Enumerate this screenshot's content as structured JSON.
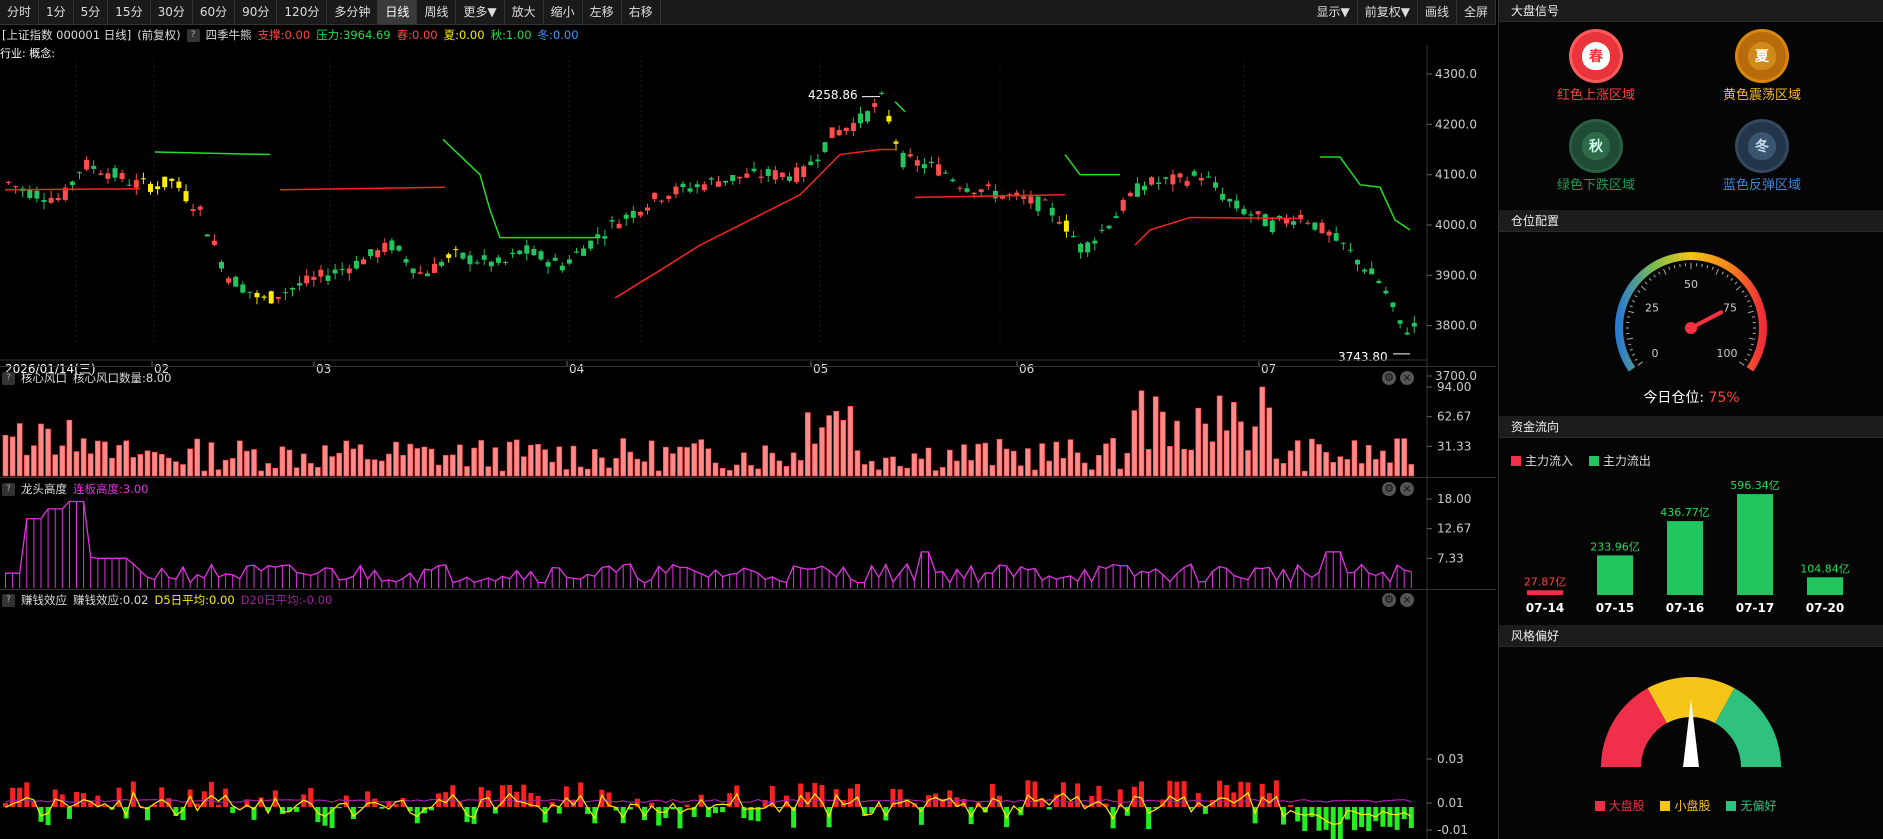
{
  "toolbar": {
    "left": [
      "分时",
      "1分",
      "5分",
      "15分",
      "30分",
      "60分",
      "90分",
      "120分",
      "多分钟",
      "日线",
      "周线",
      "更多▼",
      "放大",
      "缩小",
      "左移",
      "右移"
    ],
    "active": "日线",
    "right": [
      "显示▼",
      "前复权▼",
      "画线",
      "全屏"
    ]
  },
  "info": {
    "title": "[上证指数 000001 日线]",
    "adjust": "(前复权)",
    "indicator": "四季牛熊",
    "support": "支撑:0.00",
    "pressure": "压力:3964.69",
    "spring": "春:0.00",
    "summer": "夏:0.00",
    "autumn": "秋:1.00",
    "winter": "冬:0.00",
    "industry": "行业: 概念:"
  },
  "price_axis": [
    "4300.0",
    "4200.0",
    "4100.0",
    "4000.0",
    "3900.0",
    "3800.0",
    "3700.0"
  ],
  "price_labels": {
    "high": "4258.86",
    "low": "3743.80"
  },
  "date_axis": {
    "cursor": "2026/01/14(三)",
    "months": [
      "02",
      "03",
      "04",
      "05",
      "06",
      "07"
    ]
  },
  "panel1": {
    "name": "核心风口",
    "value": "核心风口数量:8.00",
    "axis": [
      "94.00",
      "62.67",
      "31.33"
    ]
  },
  "panel2": {
    "name": "龙头高度",
    "value": "连板高度:3.00",
    "axis": [
      "18.00",
      "12.67",
      "7.33"
    ]
  },
  "panel3": {
    "name": "赚钱效应",
    "value": "赚钱效应:0.02",
    "d5": "D5日平均:0.00",
    "d20": "D20日平均:-0.00",
    "axis": [
      "0.03",
      "0.01",
      "-0.01"
    ]
  },
  "signal": {
    "header": "大盘信号",
    "items": [
      {
        "glyph": "春",
        "label": "红色上涨区域"
      },
      {
        "glyph": "夏",
        "label": "黄色震荡区域"
      },
      {
        "glyph": "秋",
        "label": "绿色下跌区域"
      },
      {
        "glyph": "冬",
        "label": "蓝色反弹区域"
      }
    ]
  },
  "position": {
    "header": "仓位配置",
    "ticks": [
      "0",
      "25",
      "50",
      "75",
      "100"
    ],
    "label": "今日仓位:",
    "value": "75%",
    "level": 75
  },
  "fund": {
    "header": "资金流向",
    "legend": [
      "主力流入",
      "主力流出"
    ],
    "chart_data": {
      "type": "bar",
      "categories": [
        "07-14",
        "07-15",
        "07-16",
        "07-17",
        "07-20"
      ],
      "values": [
        27.87,
        233.96,
        436.77,
        596.34,
        104.84
      ],
      "labels": [
        "27.87亿",
        "233.96亿",
        "436.77亿",
        "596.34亿",
        "104.84亿"
      ],
      "colors": [
        "#f0304a",
        "#22c55e",
        "#22c55e",
        "#22c55e",
        "#22c55e"
      ]
    }
  },
  "style": {
    "header": "风格偏好",
    "legend": [
      "大盘股",
      "小盘股",
      "无偏好"
    ]
  },
  "colors": {
    "up": "#ff4d4d",
    "down": "#22c55e",
    "yellow": "#ffee00",
    "magenta": "#e033e0"
  }
}
